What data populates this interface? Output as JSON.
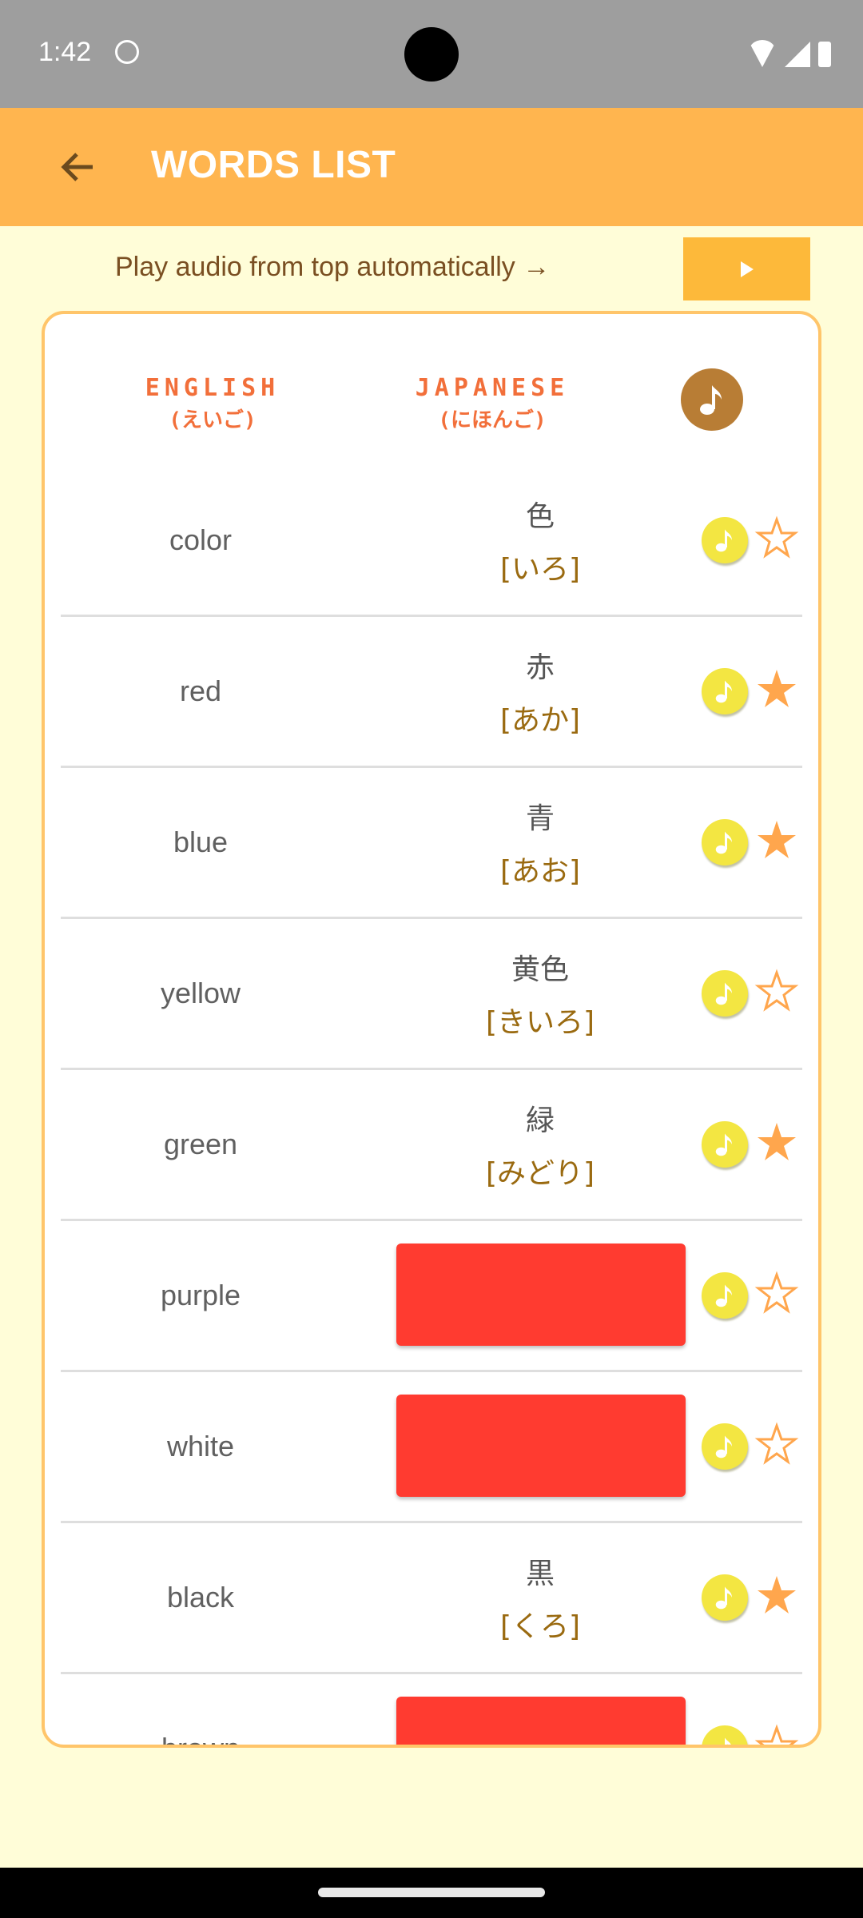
{
  "status_bar": {
    "time": "1:42"
  },
  "app_bar": {
    "title": "WORDS LIST",
    "back_icon": "arrow-left-icon"
  },
  "autoplay": {
    "label": "Play audio from top automatically →",
    "button_icon": "play-icon"
  },
  "colors": {
    "accent": "#ffb54f",
    "background": "#fffdd8",
    "header_text": "#f26f3a",
    "audio_button": "#f3e642",
    "header_audio": "#b87d35",
    "star": "#ffa64d",
    "hidden_block": "#ff3b30"
  },
  "table": {
    "headers": {
      "english": "ENGLISH",
      "english_sub": "(えいご)",
      "japanese": "JAPANESE",
      "japanese_sub": "(にほんご)"
    },
    "rows": [
      {
        "english": "color",
        "kanji": "色",
        "kana": "[いろ]",
        "hidden": false,
        "favorite": false
      },
      {
        "english": "red",
        "kanji": "赤",
        "kana": "[あか]",
        "hidden": false,
        "favorite": true
      },
      {
        "english": "blue",
        "kanji": "青",
        "kana": "[あお]",
        "hidden": false,
        "favorite": true
      },
      {
        "english": "yellow",
        "kanji": "黄色",
        "kana": "[きいろ]",
        "hidden": false,
        "favorite": false
      },
      {
        "english": "green",
        "kanji": "緑",
        "kana": "[みどり]",
        "hidden": false,
        "favorite": true
      },
      {
        "english": "purple",
        "kanji": "",
        "kana": "",
        "hidden": true,
        "favorite": false
      },
      {
        "english": "white",
        "kanji": "",
        "kana": "",
        "hidden": true,
        "favorite": false
      },
      {
        "english": "black",
        "kanji": "黒",
        "kana": "[くろ]",
        "hidden": false,
        "favorite": true
      },
      {
        "english": "brown",
        "kanji": "",
        "kana": "",
        "hidden": true,
        "favorite": false
      }
    ]
  }
}
